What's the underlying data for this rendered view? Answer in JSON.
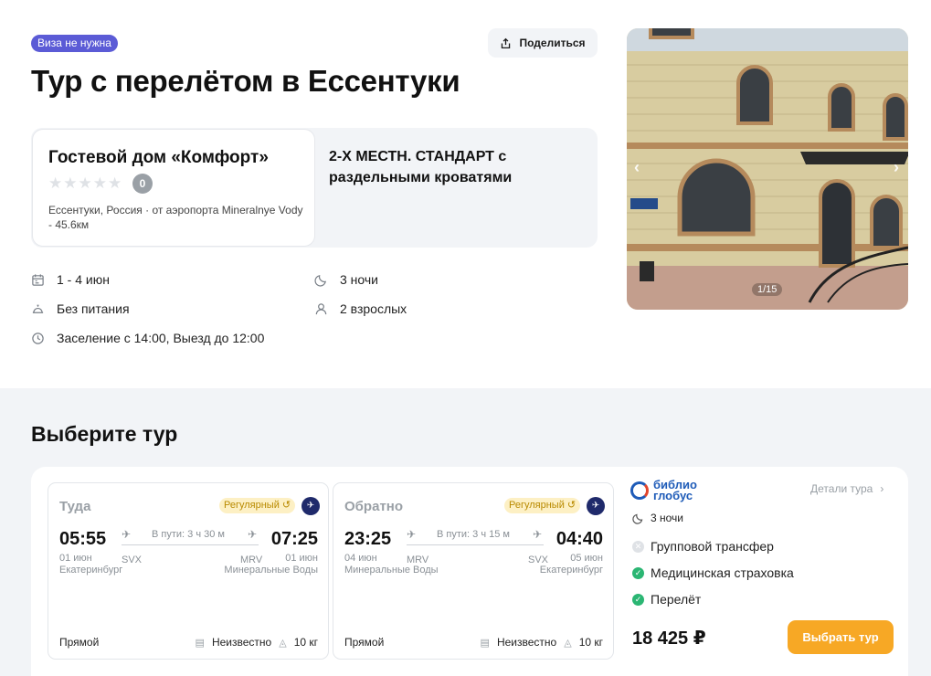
{
  "header": {
    "badge": "Виза не нужна",
    "share_label": "Поделиться",
    "title": "Тур с перелётом в Ессентуки"
  },
  "hotel": {
    "name": "Гостевой дом «Комфорт»",
    "stars": 0,
    "rating": "0",
    "location": "Ессентуки, Россия · от аэропорта Mineralnye Vody - 45.6км",
    "room": "2-Х МЕСТН. СТАНДАРТ с раздельными кроватями"
  },
  "details": {
    "dates": "1 - 4 июн",
    "nights": "3 ночи",
    "meal": "Без питания",
    "guests": "2 взрослых",
    "checkin": "Заселение с 14:00, Выезд до 12:00"
  },
  "photo": {
    "counter": "1/15",
    "sign": "Гагарина"
  },
  "section": {
    "title": "Выберите тур"
  },
  "flights": {
    "outbound": {
      "label": "Туда",
      "regular": "Регулярный",
      "dep_time": "05:55",
      "arr_time": "07:25",
      "duration": "В пути: 3 ч 30 м",
      "dep_date": "01 июн",
      "dep_code": "SVX",
      "dep_city": "Екатеринбург",
      "arr_date": "01 июн",
      "arr_code": "MRV",
      "arr_city": "Минеральные Воды",
      "direct": "Прямой",
      "cabin": "Неизвестно",
      "bag": "10 кг"
    },
    "return": {
      "label": "Обратно",
      "regular": "Регулярный",
      "dep_time": "23:25",
      "arr_time": "04:40",
      "duration": "В пути: 3 ч 15 м",
      "dep_date": "04 июн",
      "dep_code": "MRV",
      "dep_city": "Минеральные Воды",
      "arr_date": "05 июн",
      "arr_code": "SVX",
      "arr_city": "Екатеринбург",
      "direct": "Прямой",
      "cabin": "Неизвестно",
      "bag": "10 кг"
    }
  },
  "operator": {
    "logo_line1": "библио",
    "logo_line2": "глобус",
    "details_link": "Детали тура",
    "nights": "3 ночи",
    "features": [
      {
        "label": "Групповой трансфер",
        "included": false
      },
      {
        "label": "Медицинская страховка",
        "included": true
      },
      {
        "label": "Перелёт",
        "included": true
      }
    ],
    "price": "18 425 ₽",
    "select_label": "Выбрать тур"
  },
  "colors": {
    "badge": "#5b5bd6",
    "accent_button": "#f7a825",
    "included": "#2bb673",
    "regular_badge_bg": "#fdf0c4"
  }
}
